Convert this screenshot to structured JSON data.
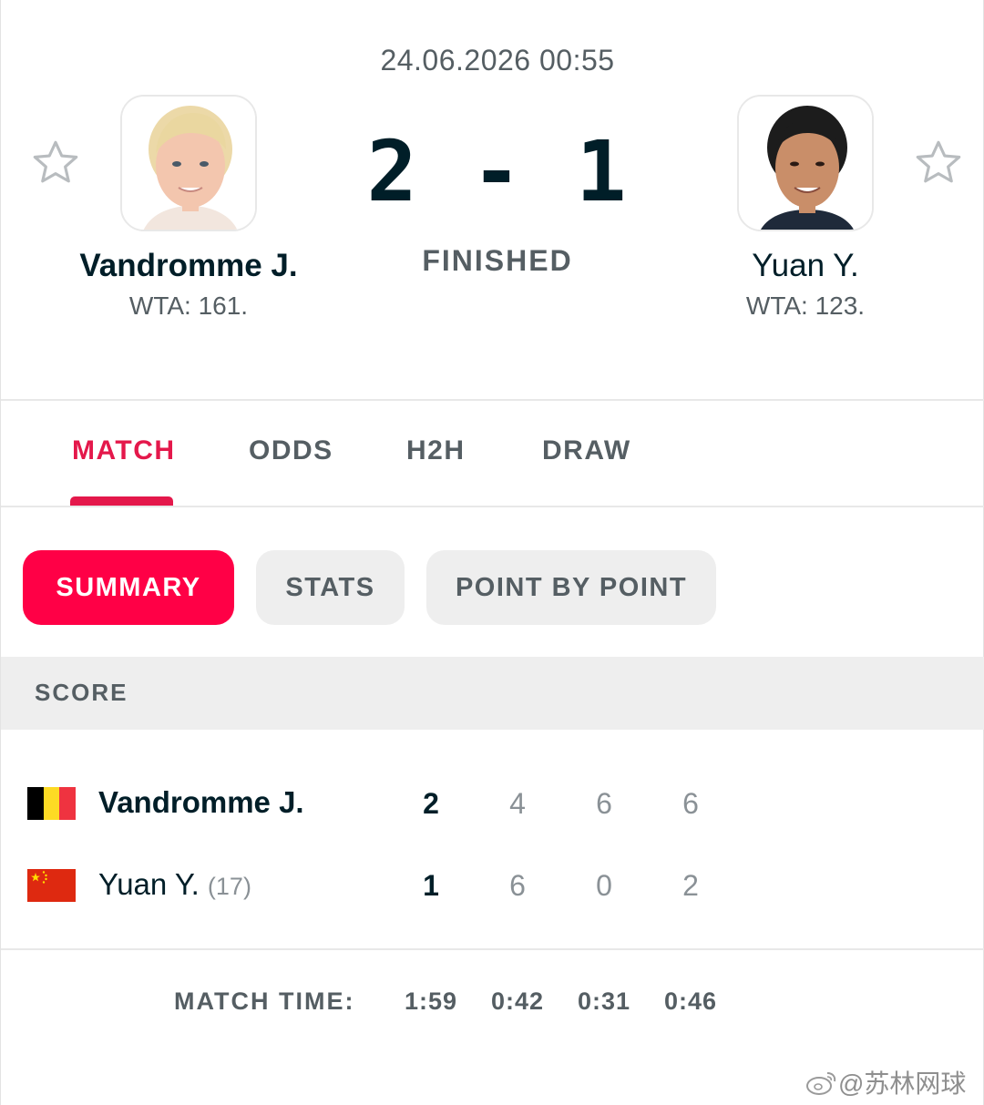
{
  "match": {
    "datetime": "24.06.2026 00:55",
    "score": "2 - 1",
    "status": "FINISHED"
  },
  "player1": {
    "name": "Vandromme J.",
    "rank": "WTA: 161.",
    "seed": "",
    "country": "Belgium",
    "sets_won": "2",
    "games": [
      "4",
      "6",
      "6"
    ]
  },
  "player2": {
    "name": "Yuan Y.",
    "rank": "WTA: 123.",
    "seed": "(17)",
    "country": "China",
    "sets_won": "1",
    "games": [
      "6",
      "0",
      "2"
    ]
  },
  "tabs": [
    {
      "label": "MATCH",
      "active": true
    },
    {
      "label": "ODDS",
      "active": false
    },
    {
      "label": "H2H",
      "active": false
    },
    {
      "label": "DRAW",
      "active": false
    }
  ],
  "subtabs": [
    {
      "label": "SUMMARY",
      "active": true
    },
    {
      "label": "STATS",
      "active": false
    },
    {
      "label": "POINT BY POINT",
      "active": false
    }
  ],
  "score_section": {
    "title": "SCORE"
  },
  "match_time": {
    "label": "MATCH TIME:",
    "total": "1:59",
    "sets": [
      "0:42",
      "0:31",
      "0:46"
    ]
  },
  "watermark": {
    "handle": "@苏林网球"
  },
  "icons": {
    "favorite": "star-outline-icon",
    "watermark_logo": "weibo-icon"
  },
  "colors": {
    "accent": "#ff0046",
    "accent_text": "#e4184b",
    "text_dark": "#001e28",
    "text_muted": "#555e63"
  }
}
